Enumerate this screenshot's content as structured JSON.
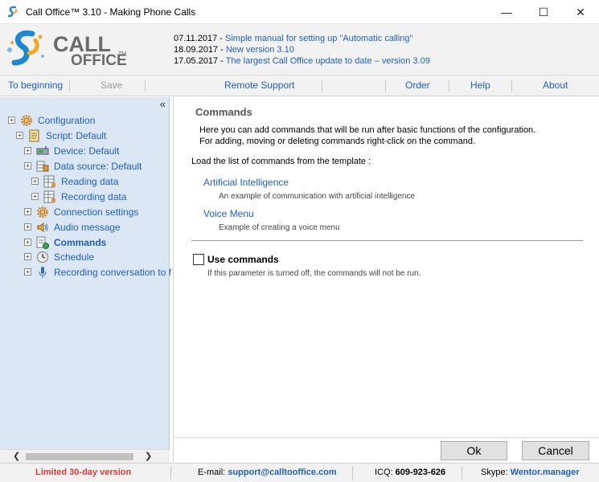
{
  "window": {
    "title": "Call Office™ 3.10 - Making Phone Calls",
    "minimize_glyph": "—",
    "maximize_glyph": "☐",
    "close_glyph": "✕"
  },
  "logo": {
    "line1": "CALL",
    "line2": "OFFICE",
    "tm": "TM"
  },
  "news": [
    {
      "date": "07.11.2017 - ",
      "text": "Simple manual for setting up \"Automatic calling\""
    },
    {
      "date": "18.09.2017 - ",
      "text": "New version 3.10"
    },
    {
      "date": "17.05.2017 - ",
      "text": "The largest Call Office update to date – version 3.09"
    }
  ],
  "toolbar": {
    "to_beginning": "To beginning",
    "save": "Save",
    "remote_support": "Remote Support",
    "order": "Order",
    "help": "Help",
    "about": "About"
  },
  "tree": {
    "collapse_glyph": "«",
    "expander_glyph": "+",
    "items": [
      {
        "label": "Configuration",
        "icon": "gear-icon"
      },
      {
        "label": "Script: Default",
        "icon": "script-icon"
      },
      {
        "label": "Device: Default",
        "icon": "device-icon"
      },
      {
        "label": "Data source: Default",
        "icon": "database-icon"
      },
      {
        "label": "Reading data",
        "icon": "table-icon"
      },
      {
        "label": "Recording data",
        "icon": "table-icon"
      },
      {
        "label": "Connection settings",
        "icon": "gear-icon"
      },
      {
        "label": "Audio message",
        "icon": "speaker-icon"
      },
      {
        "label": "Commands",
        "icon": "commands-icon"
      },
      {
        "label": "Schedule",
        "icon": "clock-icon"
      },
      {
        "label": "Recording conversation to f",
        "icon": "microphone-icon"
      }
    ],
    "scroll_left": "❮",
    "scroll_right": "❯"
  },
  "content": {
    "title": "Commands",
    "desc_line1": "Here you can add commands that will be run after basic functions of the configuration.",
    "desc_line2": "For adding, moving or deleting commands right-click on the command.",
    "load_label": "Load the list of commands from the template :",
    "templates": [
      {
        "name": "Artificial Intelligence",
        "desc": "An example of communication with artificial intelligence"
      },
      {
        "name": "Voice Menu",
        "desc": "Example of creating a voice menu"
      }
    ],
    "use_commands_label": "Use commands",
    "use_commands_checked": false,
    "use_commands_note": "If this parameter is turned off, the commands will not be run."
  },
  "buttons": {
    "ok": "Ok",
    "cancel": "Cancel"
  },
  "status": {
    "version": "Limited 30-day version",
    "email_label": "E-mail: ",
    "email": "support@calltooffice.com",
    "icq_label": "ICQ: ",
    "icq": "609-923-626",
    "skype_label": "Skype: ",
    "skype": "Wentor.manager"
  },
  "colors": {
    "link": "#1f5fbf",
    "tree_bg": "#dce7f5",
    "trial_red": "#e23a3a"
  }
}
